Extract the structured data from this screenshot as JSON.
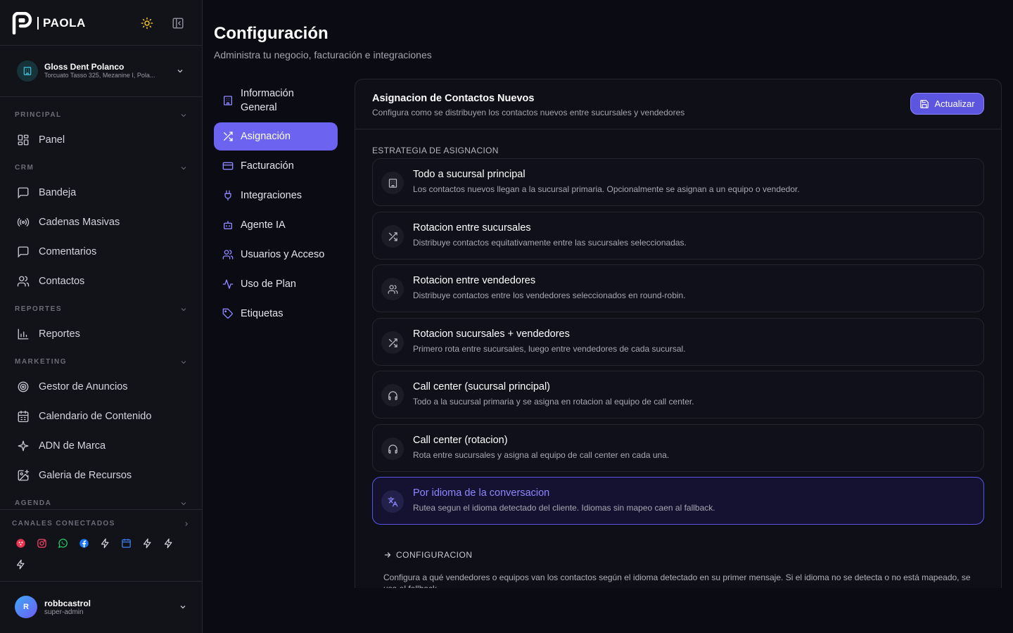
{
  "brand": {
    "name": "PAOLA"
  },
  "workspace": {
    "name": "Gloss Dent Polanco",
    "address": "Torcuato Tasso 325, Mezanine I, Pola..."
  },
  "sidebar": {
    "sections": [
      {
        "title": "PRINCIPAL",
        "items": [
          {
            "label": "Panel",
            "icon": "grid-icon"
          }
        ]
      },
      {
        "title": "CRM",
        "items": [
          {
            "label": "Bandeja",
            "icon": "message-square-icon"
          },
          {
            "label": "Cadenas Masivas",
            "icon": "broadcast-icon"
          },
          {
            "label": "Comentarios",
            "icon": "comment-icon"
          },
          {
            "label": "Contactos",
            "icon": "users-icon"
          }
        ]
      },
      {
        "title": "REPORTES",
        "items": [
          {
            "label": "Reportes",
            "icon": "bar-chart-icon"
          }
        ]
      },
      {
        "title": "MARKETING",
        "items": [
          {
            "label": "Gestor de Anuncios",
            "icon": "target-icon"
          },
          {
            "label": "Calendario de Contenido",
            "icon": "calendar-icon"
          },
          {
            "label": "ADN de Marca",
            "icon": "sparkle-icon"
          },
          {
            "label": "Galeria de Recursos",
            "icon": "image-plus-icon"
          }
        ]
      },
      {
        "title": "AGENDA",
        "items": []
      }
    ],
    "channels": {
      "title": "CANALES CONECTADOS",
      "icons": [
        "bot-channel-icon",
        "instagram-icon",
        "whatsapp-icon",
        "facebook-icon",
        "bolt-icon",
        "calendar-channel-icon",
        "bolt-icon",
        "bolt-icon",
        "bolt-icon"
      ]
    }
  },
  "user": {
    "initial": "R",
    "name": "robbcastrol",
    "role": "super-admin"
  },
  "page": {
    "title": "Configuración",
    "subtitle": "Administra tu negocio, facturación e integraciones"
  },
  "settings_nav": [
    {
      "label": "Información General",
      "active": false
    },
    {
      "label": "Asignación",
      "active": true
    },
    {
      "label": "Facturación",
      "active": false
    },
    {
      "label": "Integraciones",
      "active": false
    },
    {
      "label": "Agente IA",
      "active": false
    },
    {
      "label": "Usuarios y Acceso",
      "active": false
    },
    {
      "label": "Uso de Plan",
      "active": false
    },
    {
      "label": "Etiquetas",
      "active": false
    }
  ],
  "panel": {
    "title": "Asignacion de Contactos Nuevos",
    "subtitle": "Configura como se distribuyen los contactos nuevos entre sucursales y vendedores",
    "update_button": "Actualizar",
    "strategy_label": "ESTRATEGIA DE ASIGNACION",
    "options": [
      {
        "title": "Todo a sucursal principal",
        "desc": "Los contactos nuevos llegan a la sucursal primaria. Opcionalmente se asignan a un equipo o vendedor.",
        "icon": "building-icon",
        "selected": false
      },
      {
        "title": "Rotacion entre sucursales",
        "desc": "Distribuye contactos equitativamente entre las sucursales seleccionadas.",
        "icon": "shuffle-icon",
        "selected": false
      },
      {
        "title": "Rotacion entre vendedores",
        "desc": "Distribuye contactos entre los vendedores seleccionados en round-robin.",
        "icon": "users-icon",
        "selected": false
      },
      {
        "title": "Rotacion sucursales + vendedores",
        "desc": "Primero rota entre sucursales, luego entre vendedores de cada sucursal.",
        "icon": "shuffle-icon",
        "selected": false
      },
      {
        "title": "Call center (sucursal principal)",
        "desc": "Todo a la sucursal primaria y se asigna en rotacion al equipo de call center.",
        "icon": "headphones-icon",
        "selected": false
      },
      {
        "title": "Call center (rotacion)",
        "desc": "Rota entre sucursales y asigna al equipo de call center en cada una.",
        "icon": "headphones-icon",
        "selected": false
      },
      {
        "title": "Por idioma de la conversacion",
        "desc": "Rutea segun el idioma detectado del cliente. Idiomas sin mapeo caen al fallback.",
        "icon": "languages-icon",
        "selected": true
      }
    ],
    "config_label": "CONFIGURACION",
    "config_text": "Configura a qué vendedores o equipos van los contactos según el idioma detectado en su primer mensaje. Si el idioma no se detecta o no está mapeado, se usa el fallback."
  },
  "colors": {
    "accent": "#6c63f0",
    "background": "#0b0b14",
    "sidebar": "#121219",
    "sun": "#f5c518"
  }
}
